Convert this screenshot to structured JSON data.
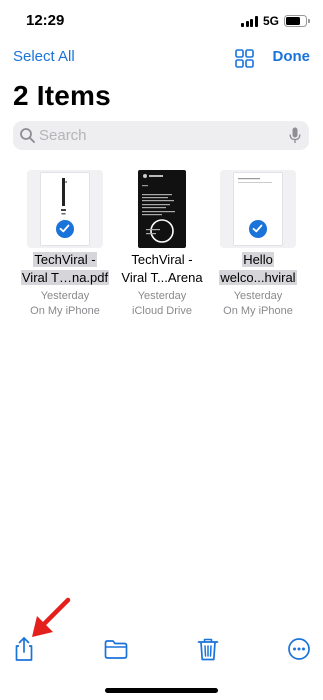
{
  "status_bar": {
    "time": "12:29",
    "network": "5G",
    "battery_level": 0.75
  },
  "nav": {
    "select_all_label": "Select All",
    "done_label": "Done",
    "grid_icon": "grid-icon"
  },
  "page": {
    "title": "2 Items"
  },
  "search": {
    "placeholder": "Search"
  },
  "files": [
    {
      "name_line1": "TechViral -",
      "name_line2": "Viral T…na.pdf",
      "date": "Yesterday",
      "location": "On My iPhone",
      "selected": true
    },
    {
      "name_line1": "TechViral -",
      "name_line2": "Viral T...Arena",
      "date": "Yesterday",
      "location": "iCloud Drive",
      "selected": false
    },
    {
      "name_line1": "Hello",
      "name_line2": "welco...hviral",
      "date": "Yesterday",
      "location": "On My iPhone",
      "selected": true
    }
  ],
  "toolbar": {
    "share_icon": "share-icon",
    "folder_icon": "folder-icon",
    "trash_icon": "trash-icon",
    "more_icon": "more-icon"
  },
  "colors": {
    "accent": "#1a73d9",
    "annotation": "#e3201b",
    "selection_highlight": "#d6d6da"
  }
}
